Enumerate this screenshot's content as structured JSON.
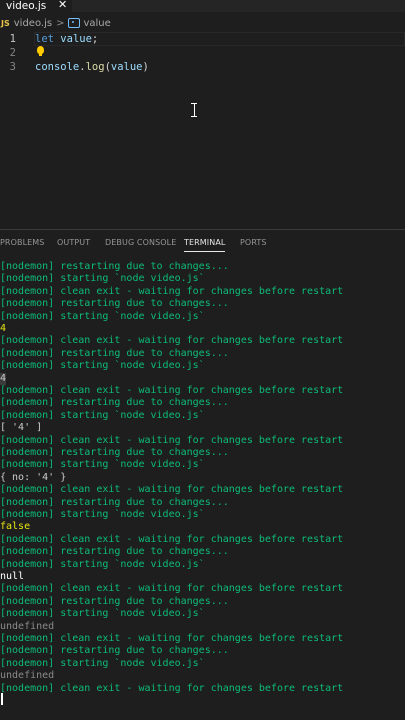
{
  "tab": {
    "label": "video.js",
    "close": "✕"
  },
  "breadcrumb": {
    "file_badge": "JS",
    "file": "video.js",
    "separator": ">",
    "symbol": "value"
  },
  "editor": {
    "lines": [
      {
        "number": "1",
        "tokens": [
          {
            "t": "let",
            "c": "kw"
          },
          {
            "t": " ",
            "c": "punc"
          },
          {
            "t": "value",
            "c": "var"
          },
          {
            "t": ";",
            "c": "punc"
          }
        ]
      },
      {
        "number": "2",
        "tokens": []
      },
      {
        "number": "3",
        "tokens": [
          {
            "t": "console",
            "c": "var"
          },
          {
            "t": ".",
            "c": "punc"
          },
          {
            "t": "log",
            "c": "fn"
          },
          {
            "t": "(",
            "c": "punc"
          },
          {
            "t": "value",
            "c": "var"
          },
          {
            "t": ")",
            "c": "punc"
          }
        ]
      }
    ]
  },
  "panel": {
    "tabs": [
      "PROBLEMS",
      "OUTPUT",
      "DEBUG CONSOLE",
      "TERMINAL",
      "PORTS"
    ],
    "active_tab": "TERMINAL"
  },
  "terminal": {
    "lines": [
      {
        "text": "[nodemon] restarting due to changes...",
        "color": "green"
      },
      {
        "text": "[nodemon] starting `node video.js`",
        "color": "green"
      },
      {
        "text": "[nodemon] clean exit - waiting for changes before restart",
        "color": "green"
      },
      {
        "text": "[nodemon] restarting due to changes...",
        "color": "green"
      },
      {
        "text": "[nodemon] starting `node video.js`",
        "color": "green"
      },
      {
        "text": "4",
        "color": "yellow"
      },
      {
        "text": "[nodemon] clean exit - waiting for changes before restart",
        "color": "green"
      },
      {
        "text": "[nodemon] restarting due to changes...",
        "color": "green"
      },
      {
        "text": "[nodemon] starting `node video.js`",
        "color": "green"
      },
      {
        "text": "4",
        "color": "hl"
      },
      {
        "text": "[nodemon] clean exit - waiting for changes before restart",
        "color": "green"
      },
      {
        "text": "[nodemon] restarting due to changes...",
        "color": "green"
      },
      {
        "text": "[nodemon] starting `node video.js`",
        "color": "green"
      },
      {
        "text": "[ '4' ]",
        "color": "default"
      },
      {
        "text": "[nodemon] clean exit - waiting for changes before restart",
        "color": "green"
      },
      {
        "text": "[nodemon] restarting due to changes...",
        "color": "green"
      },
      {
        "text": "[nodemon] starting `node video.js`",
        "color": "green"
      },
      {
        "text": "{ no: '4' }",
        "color": "default"
      },
      {
        "text": "[nodemon] clean exit - waiting for changes before restart",
        "color": "green"
      },
      {
        "text": "[nodemon] restarting due to changes...",
        "color": "green"
      },
      {
        "text": "[nodemon] starting `node video.js`",
        "color": "green"
      },
      {
        "text": "false",
        "color": "yellow"
      },
      {
        "text": "[nodemon] clean exit - waiting for changes before restart",
        "color": "green"
      },
      {
        "text": "[nodemon] restarting due to changes...",
        "color": "green"
      },
      {
        "text": "[nodemon] starting `node video.js`",
        "color": "green"
      },
      {
        "text": "null",
        "color": "white"
      },
      {
        "text": "[nodemon] clean exit - waiting for changes before restart",
        "color": "green"
      },
      {
        "text": "[nodemon] restarting due to changes...",
        "color": "green"
      },
      {
        "text": "[nodemon] starting `node video.js`",
        "color": "green"
      },
      {
        "text": "undefined",
        "color": "gray"
      },
      {
        "text": "[nodemon] clean exit - waiting for changes before restart",
        "color": "green"
      },
      {
        "text": "[nodemon] restarting due to changes...",
        "color": "green"
      },
      {
        "text": "[nodemon] starting `node video.js`",
        "color": "green"
      },
      {
        "text": "undefined",
        "color": "gray"
      },
      {
        "text": "[nodemon] clean exit - waiting for changes before restart",
        "color": "green"
      }
    ]
  },
  "colors": {
    "background": "#1e1e1e",
    "terminal_green": "#0dbc79",
    "terminal_yellow": "#e5e510",
    "keyword": "#569cd6",
    "variable": "#9cdcfe",
    "function": "#dcdcaa"
  }
}
